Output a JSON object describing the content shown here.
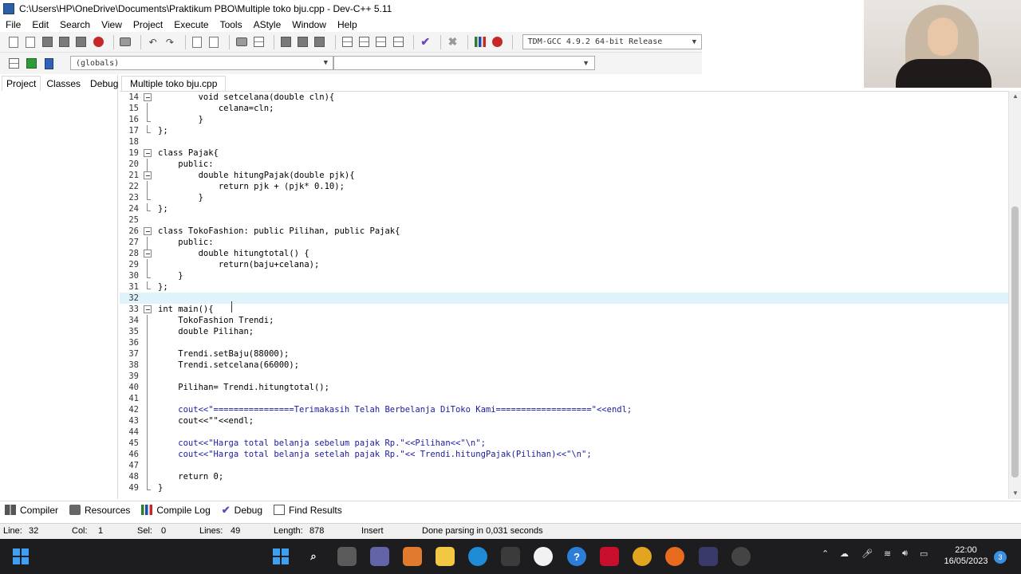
{
  "window": {
    "title": "C:\\Users\\HP\\OneDrive\\Documents\\Praktikum PBO\\Multiple toko bju.cpp - Dev-C++ 5.11"
  },
  "menu": [
    "File",
    "Edit",
    "Search",
    "View",
    "Project",
    "Execute",
    "Tools",
    "AStyle",
    "Window",
    "Help"
  ],
  "toolbar": {
    "compiler": "TDM-GCC 4.9.2 64-bit Release",
    "scope": "(globals)",
    "member": ""
  },
  "left_panel": {
    "tabs": [
      "Project",
      "Classes",
      "Debug"
    ]
  },
  "editor": {
    "file_tab": "Multiple toko bju.cpp",
    "current_line": 32,
    "lines": [
      {
        "n": "14",
        "fold": "box",
        "text": "        void setcelana(double cln){",
        "style": ""
      },
      {
        "n": "15",
        "fold": "line",
        "text": "            celana=cln;",
        "style": ""
      },
      {
        "n": "16",
        "fold": "end",
        "text": "        }",
        "style": ""
      },
      {
        "n": "17",
        "fold": "end",
        "text": "};",
        "style": ""
      },
      {
        "n": "18",
        "fold": "",
        "text": "",
        "style": ""
      },
      {
        "n": "19",
        "fold": "box",
        "text": "class Pajak{",
        "style": ""
      },
      {
        "n": "20",
        "fold": "line",
        "text": "    public:",
        "style": ""
      },
      {
        "n": "21",
        "fold": "box",
        "text": "        double hitungPajak(double pjk){",
        "style": ""
      },
      {
        "n": "22",
        "fold": "line",
        "text": "            return pjk + (pjk* 0.10);",
        "style": ""
      },
      {
        "n": "23",
        "fold": "end",
        "text": "        }",
        "style": ""
      },
      {
        "n": "24",
        "fold": "end",
        "text": "};",
        "style": ""
      },
      {
        "n": "25",
        "fold": "",
        "text": "",
        "style": ""
      },
      {
        "n": "26",
        "fold": "box",
        "text": "class TokoFashion: public Pilihan, public Pajak{",
        "style": ""
      },
      {
        "n": "27",
        "fold": "line",
        "text": "    public:",
        "style": ""
      },
      {
        "n": "28",
        "fold": "box",
        "text": "        double hitungtotal() {",
        "style": ""
      },
      {
        "n": "29",
        "fold": "line",
        "text": "            return(baju+celana);",
        "style": ""
      },
      {
        "n": "30",
        "fold": "end",
        "text": "    }",
        "style": ""
      },
      {
        "n": "31",
        "fold": "end",
        "text": "};",
        "style": ""
      },
      {
        "n": "32",
        "fold": "",
        "text": "",
        "style": ""
      },
      {
        "n": "33",
        "fold": "box",
        "text": "int main(){",
        "style": ""
      },
      {
        "n": "34",
        "fold": "line",
        "text": "    TokoFashion Trendi;",
        "style": ""
      },
      {
        "n": "35",
        "fold": "line",
        "text": "    double Pilihan;",
        "style": ""
      },
      {
        "n": "36",
        "fold": "line",
        "text": "",
        "style": ""
      },
      {
        "n": "37",
        "fold": "line",
        "text": "    Trendi.setBaju(88000);",
        "style": ""
      },
      {
        "n": "38",
        "fold": "line",
        "text": "    Trendi.setcelana(66000);",
        "style": ""
      },
      {
        "n": "39",
        "fold": "line",
        "text": "",
        "style": ""
      },
      {
        "n": "40",
        "fold": "line",
        "text": "    Pilihan= Trendi.hitungtotal();",
        "style": ""
      },
      {
        "n": "41",
        "fold": "line",
        "text": "",
        "style": ""
      },
      {
        "n": "42",
        "fold": "line",
        "text": "    cout<<\"================Terimakasih Telah Berbelanja DiToko Kami===================\"<<endl;",
        "style": "str"
      },
      {
        "n": "43",
        "fold": "line",
        "text": "    cout<<\"\"<<endl;",
        "style": ""
      },
      {
        "n": "44",
        "fold": "line",
        "text": "",
        "style": ""
      },
      {
        "n": "45",
        "fold": "line",
        "text": "    cout<<\"Harga total belanja sebelum pajak Rp.\"<<Pilihan<<\"\\n\";",
        "style": "str"
      },
      {
        "n": "46",
        "fold": "line",
        "text": "    cout<<\"Harga total belanja setelah pajak Rp.\"<< Trendi.hitungPajak(Pilihan)<<\"\\n\";",
        "style": "str"
      },
      {
        "n": "47",
        "fold": "line",
        "text": "",
        "style": ""
      },
      {
        "n": "48",
        "fold": "line",
        "text": "    return 0;",
        "style": ""
      },
      {
        "n": "49",
        "fold": "end",
        "text": "}",
        "style": ""
      }
    ]
  },
  "bottom_tabs": [
    "Compiler",
    "Resources",
    "Compile Log",
    "Debug",
    "Find Results"
  ],
  "status": {
    "line_label": "Line:",
    "line_value": "32",
    "col_label": "Col:",
    "col_value": "1",
    "sel_label": "Sel:",
    "sel_value": "0",
    "lines_label": "Lines:",
    "lines_value": "49",
    "length_label": "Length:",
    "length_value": "878",
    "mode": "Insert",
    "message": "Done parsing in 0,031 seconds"
  },
  "taskbar": {
    "time": "22:00",
    "date": "16/05/2023",
    "notifications": "3"
  },
  "colors": {
    "current_line": "#dff3fb",
    "string": "#1a1aa6",
    "taskbar": "#1d1d1f"
  }
}
